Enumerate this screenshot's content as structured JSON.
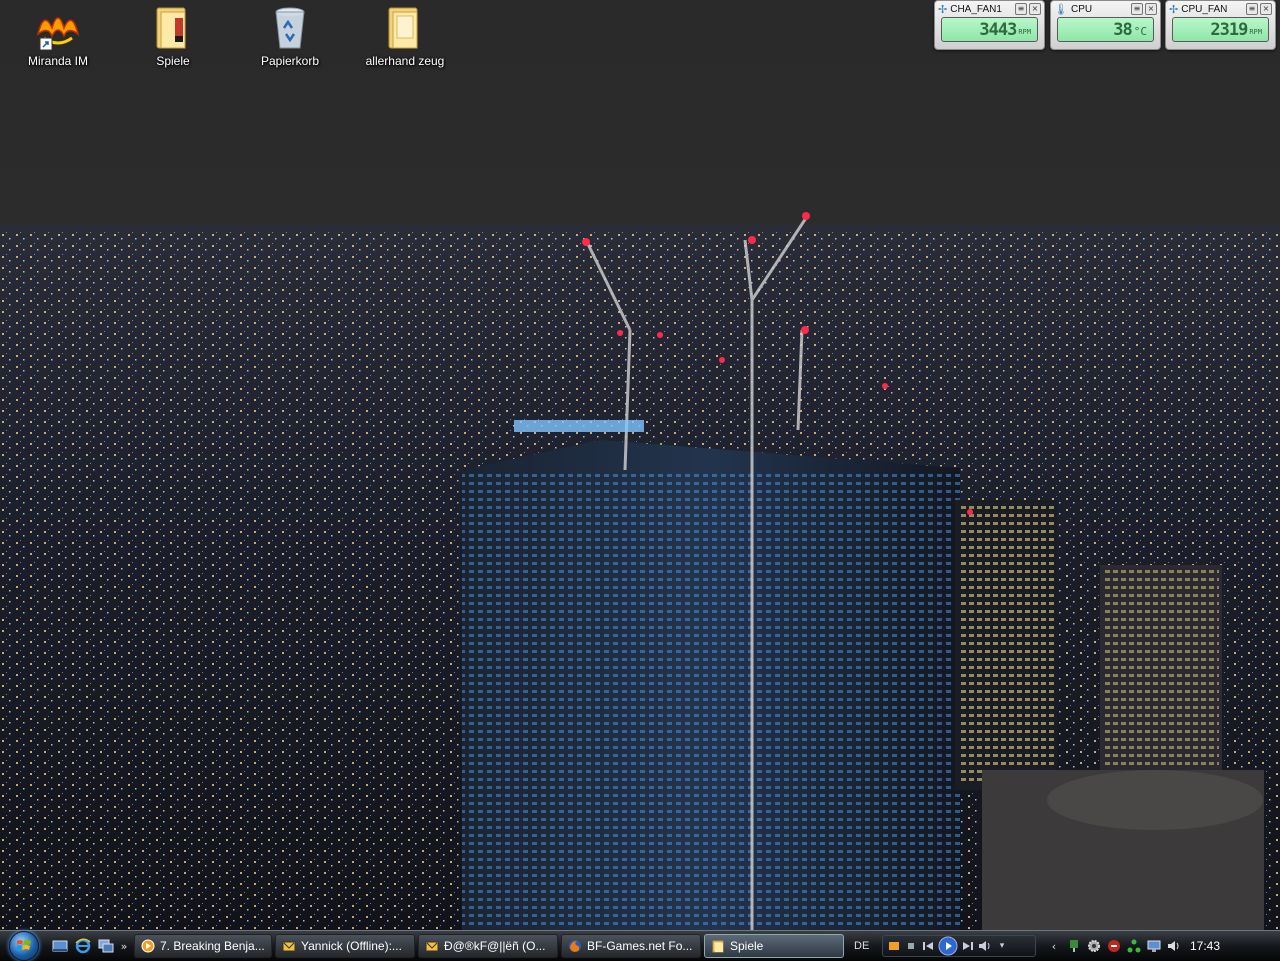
{
  "desktop": {
    "icons": [
      {
        "label": "Miranda IM",
        "icon": "miranda-icon"
      },
      {
        "label": "Spiele",
        "icon": "folder-icon"
      },
      {
        "label": "Papierkorb",
        "icon": "recycle-bin-icon"
      },
      {
        "label": "allerhand zeug",
        "icon": "folder-icon"
      }
    ]
  },
  "gadgets": [
    {
      "title": "CHA_FAN1",
      "value": "3443",
      "unit": "RPM",
      "icon": "fan-icon"
    },
    {
      "title": "CPU",
      "value": "38",
      "unit": "°C",
      "icon": "thermometer-icon"
    },
    {
      "title": "CPU_FAN",
      "value": "2319",
      "unit": "RPM",
      "icon": "fan-icon"
    }
  ],
  "taskbar": {
    "quick_launch": [
      "show-desktop-icon",
      "internet-explorer-icon",
      "switch-windows-icon"
    ],
    "overflow": "»",
    "tasks": [
      {
        "label": "7. Breaking Benja...",
        "icon": "media-player-icon"
      },
      {
        "label": "Yannick (Offline):...",
        "icon": "chat-window-icon"
      },
      {
        "label": "Ð@®kF@||ëñ (O...",
        "icon": "chat-window-icon"
      },
      {
        "label": "BF-Games.net Fo...",
        "icon": "firefox-icon"
      },
      {
        "label": "Spiele",
        "icon": "folder-icon"
      }
    ],
    "language": "DE",
    "clock": "17:43"
  },
  "colors": {
    "sky": "#2b2b2b",
    "lcd_green": "#9ef0b5",
    "taskbar": "#15181c"
  }
}
